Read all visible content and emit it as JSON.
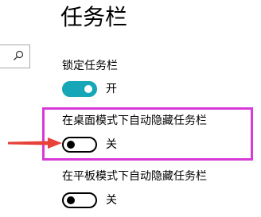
{
  "header": {
    "title": "任务栏"
  },
  "settings": [
    {
      "label": "锁定任务栏",
      "state": "开",
      "on": true
    },
    {
      "label": "在桌面模式下自动隐藏任务栏",
      "state": "关",
      "on": false
    },
    {
      "label": "在平板模式下自动隐藏任务栏",
      "state": "关",
      "on": false
    }
  ],
  "icons": {
    "search": "search-icon",
    "annotation_arrow": "arrow-right-icon"
  },
  "colors": {
    "toggle_on": "#15a7b7",
    "highlight": "#d83ad8",
    "arrow": "#e8413a"
  }
}
